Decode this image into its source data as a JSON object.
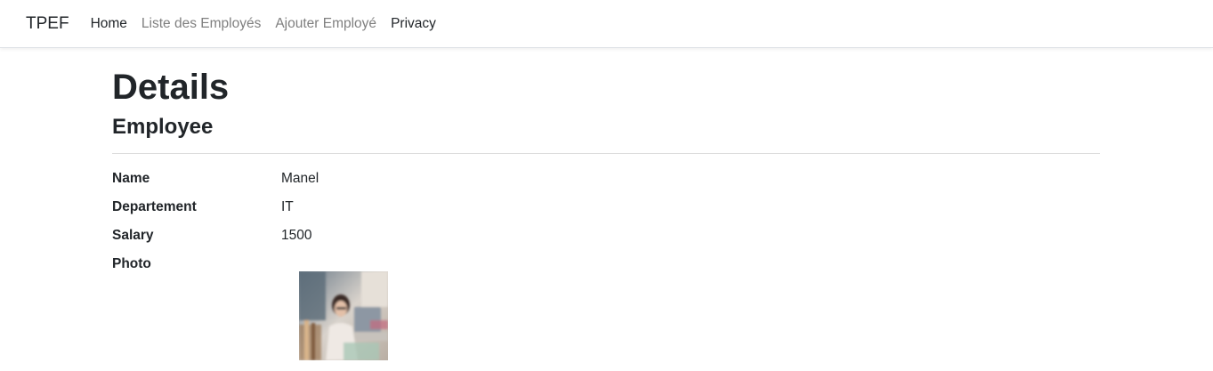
{
  "navbar": {
    "brand": "TPEF",
    "links": [
      {
        "label": "Home"
      },
      {
        "label": "Liste des Employés"
      },
      {
        "label": "Ajouter Employé"
      },
      {
        "label": "Privacy"
      }
    ]
  },
  "page": {
    "title": "Details",
    "section": "Employee"
  },
  "details": [
    {
      "label": "Name",
      "value": "Manel"
    },
    {
      "label": "Departement",
      "value": "IT"
    },
    {
      "label": "Salary",
      "value": "1500"
    },
    {
      "label": "Photo",
      "value": ""
    }
  ],
  "colors": {
    "text": "#212529",
    "muted_link": "#7f7f7f",
    "divider": "#dcdcdc"
  }
}
